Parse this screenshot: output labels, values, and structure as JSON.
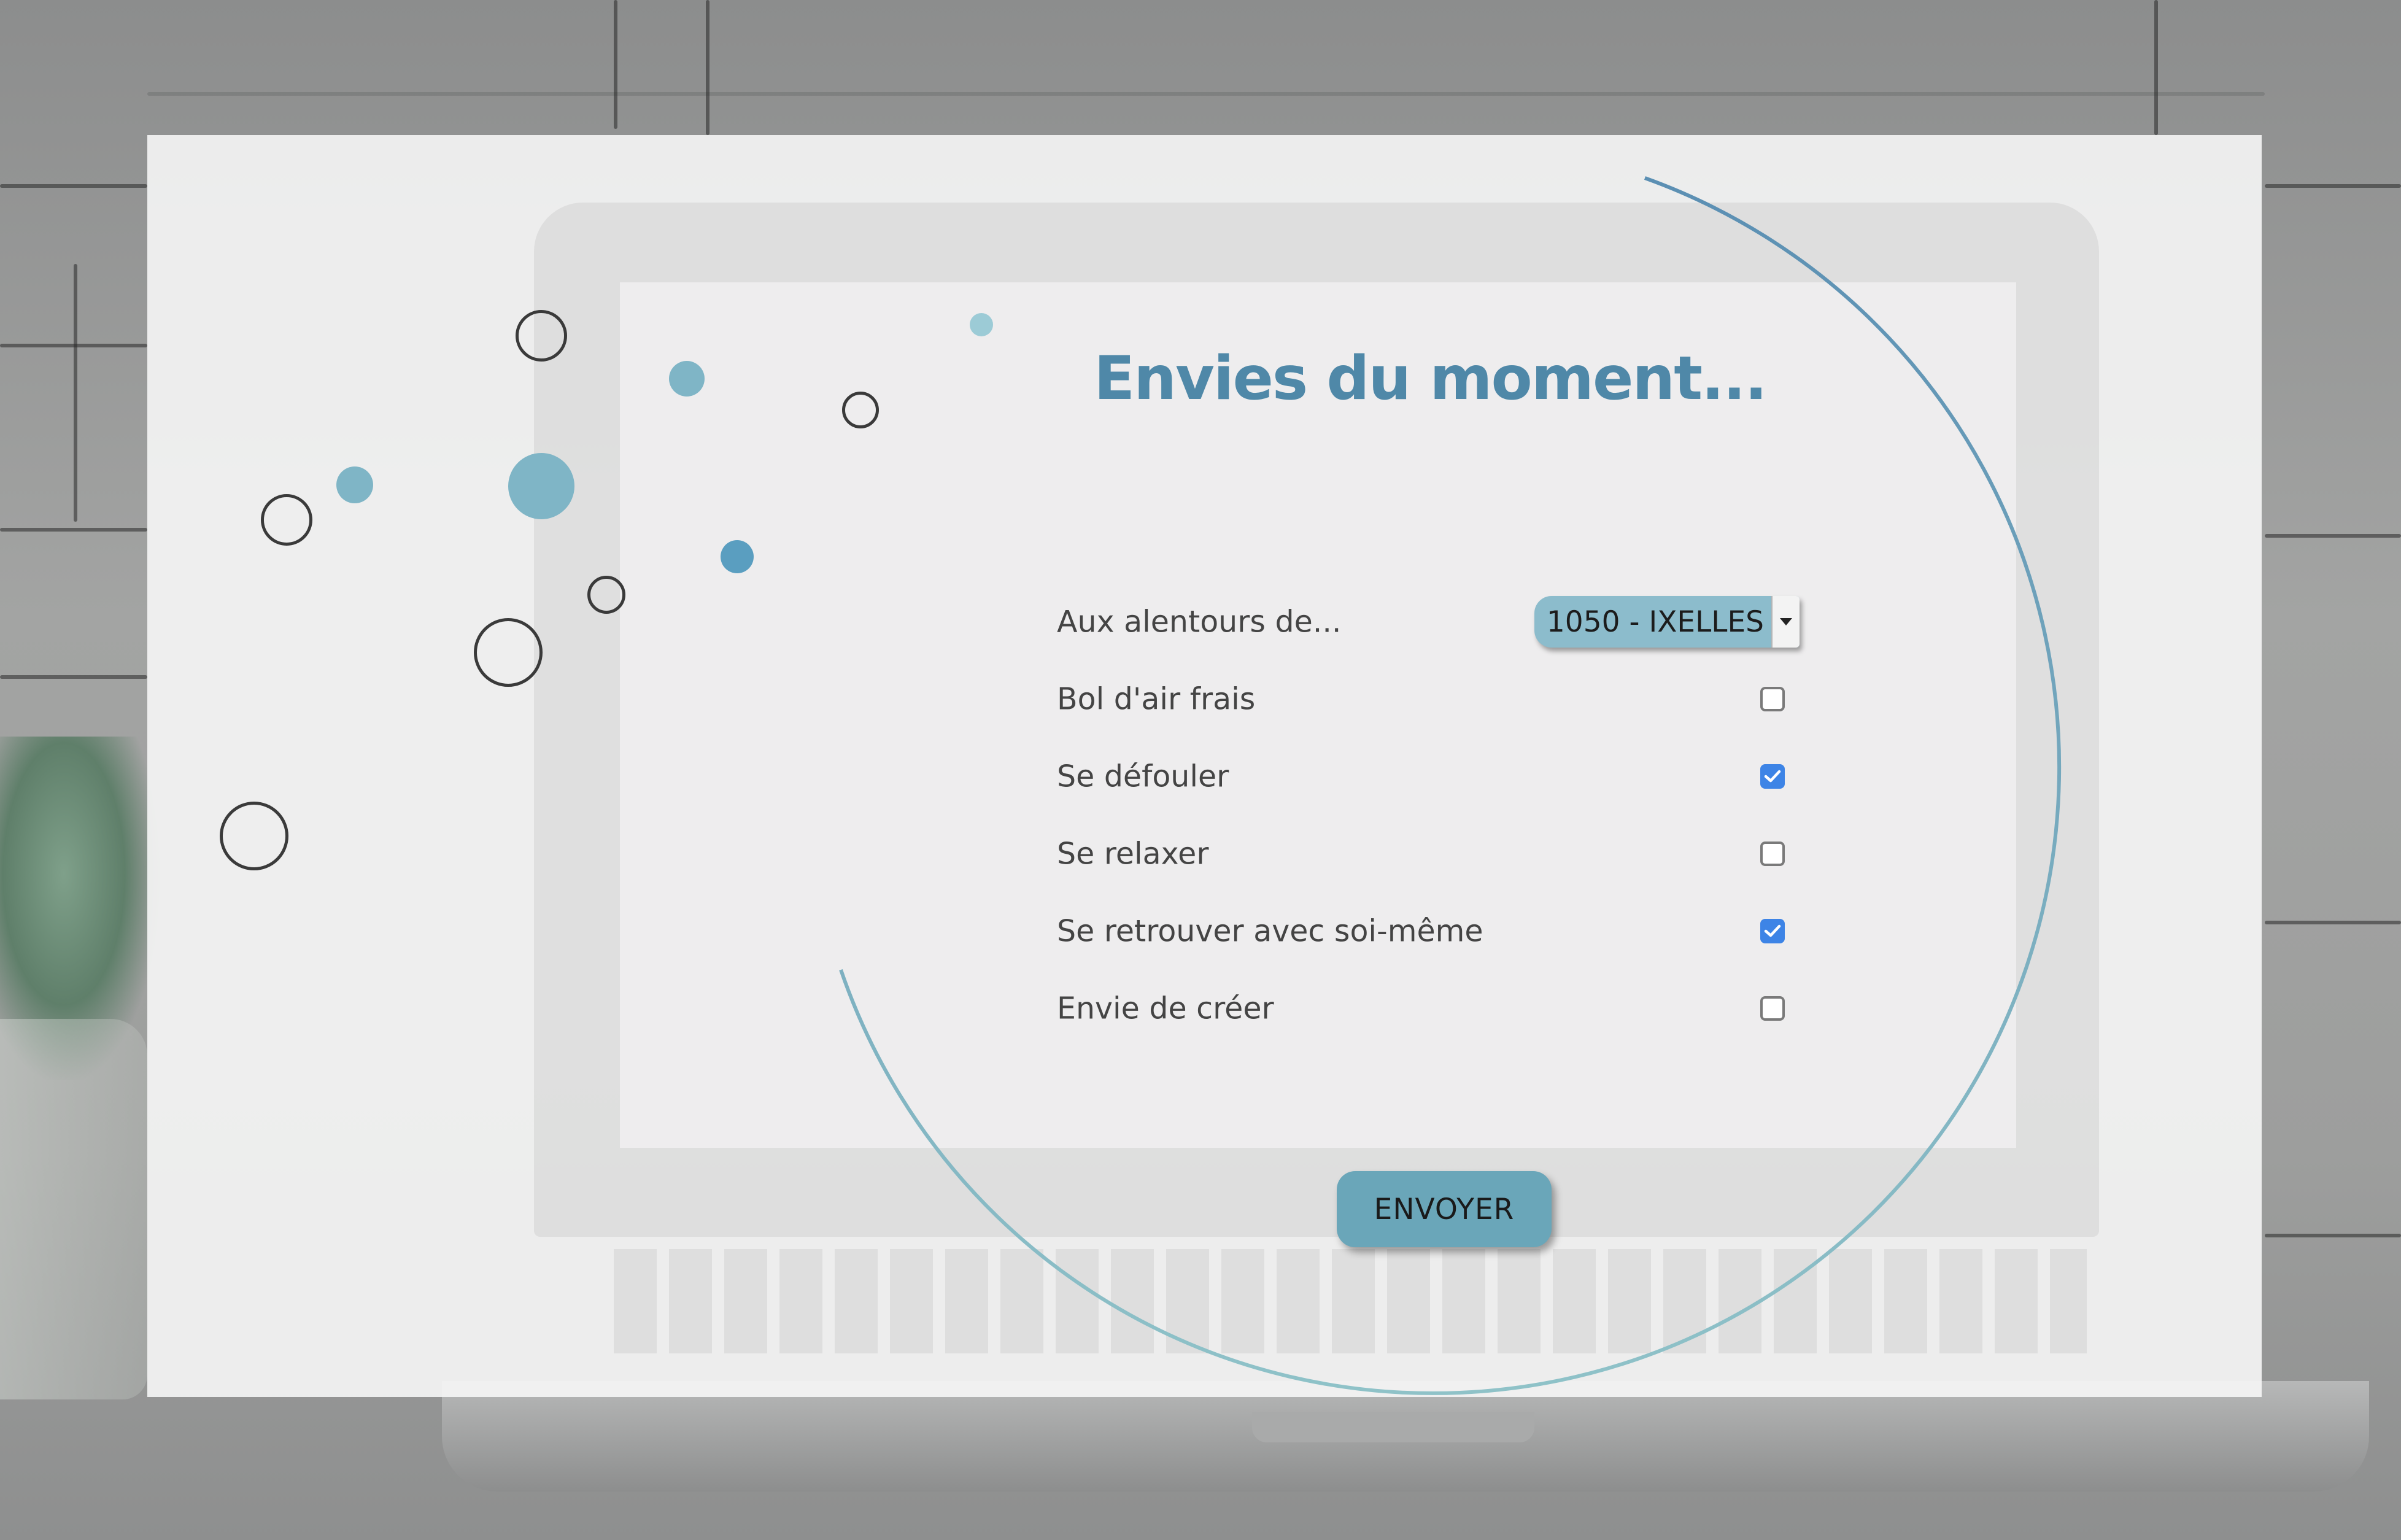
{
  "form": {
    "title": "Envies du moment...",
    "location": {
      "label": "Aux alentours de...",
      "selected": "1050 - IXELLES"
    },
    "options": [
      {
        "label": "Bol d'air frais",
        "checked": false
      },
      {
        "label": "Se défouler",
        "checked": true
      },
      {
        "label": "Se relaxer",
        "checked": false
      },
      {
        "label": "Se retrouver avec soi-même",
        "checked": true
      },
      {
        "label": "Envie de créer",
        "checked": false
      }
    ],
    "submit_label": "ENVOYER"
  },
  "colors": {
    "title": "#4f88a8",
    "accent": "#8cbccc",
    "button": "#6aa6b9",
    "checkbox_checked": "#3d84e6",
    "bubble_filled": "#7fb5c6",
    "arc_start": "#5b8fb3",
    "arc_end": "#8fc2c8"
  },
  "icons": {
    "select_arrow": "caret-down-icon",
    "checkbox_check": "check-icon"
  }
}
